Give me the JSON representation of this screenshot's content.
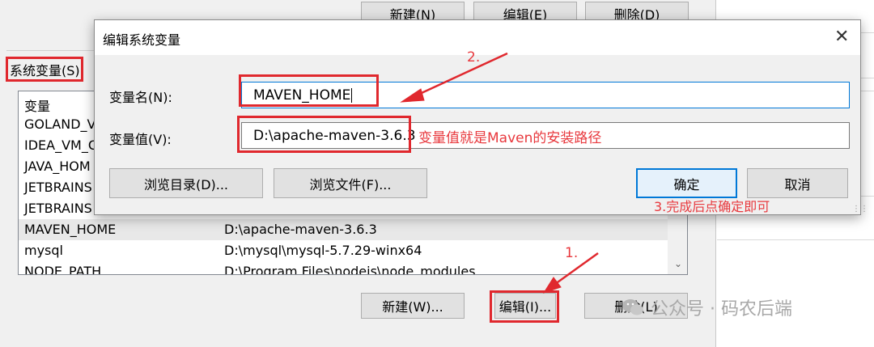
{
  "background_window": {
    "top_buttons": [
      "新建(N)",
      "编辑(E)",
      "删除(D)"
    ],
    "section_label": "系统变量(S)",
    "list_header": {
      "name": "变量"
    },
    "rows": [
      {
        "name": "GOLAND_V",
        "value": ""
      },
      {
        "name": "IDEA_VM_C",
        "value": ""
      },
      {
        "name": "JAVA_HOM",
        "value": ""
      },
      {
        "name": "JETBRAINS",
        "value": ""
      },
      {
        "name": "JETBRAINS",
        "value": ""
      },
      {
        "name": "MAVEN_HOME",
        "value": "D:\\apache-maven-3.6.3"
      },
      {
        "name": "mysql",
        "value": "D:\\mysql\\mysql-5.7.29-winx64"
      },
      {
        "name": "NODE_PATH",
        "value": "D:\\Program Files\\nodejs\\node_modules"
      }
    ],
    "selected_row_index": 5,
    "bottom_buttons": {
      "new": "新建(W)...",
      "edit": "编辑(I)...",
      "delete": "删除(L)"
    }
  },
  "dialog": {
    "title": "编辑系统变量",
    "name_label": "变量名(N):",
    "name_value": "MAVEN_HOME",
    "value_label": "变量值(V):",
    "value_value": "D:\\apache-maven-3.6.3",
    "browse_dir_button": "浏览目录(D)...",
    "browse_file_button": "浏览文件(F)...",
    "ok_button": "确定",
    "cancel_button": "取消"
  },
  "annotations": {
    "step1": "1.",
    "step2": "2.",
    "step3": "3.完成后点确定即可",
    "value_note": "变量值就是Maven的安装路径",
    "color": "#e8383d"
  },
  "watermark": {
    "text": "公众号 · 码农后端",
    "icon": "wechat-icon"
  }
}
